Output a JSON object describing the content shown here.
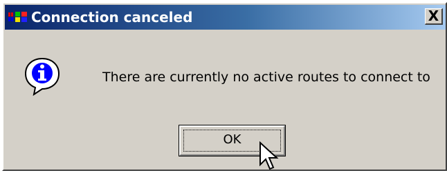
{
  "window": {
    "title": "Connection canceled",
    "close_glyph": "X",
    "app_icon": "windows-flag-icon"
  },
  "message": {
    "icon": "info-icon",
    "text": "There are currently no active routes to connect to"
  },
  "buttons": {
    "ok_label": "OK"
  },
  "colors": {
    "titlebar_start": "#0a246a",
    "titlebar_end": "#a6caf0",
    "dialog_face": "#d4d0c8",
    "info_icon": "#0000ff"
  },
  "cursor": {
    "icon": "mouse-pointer-icon"
  }
}
